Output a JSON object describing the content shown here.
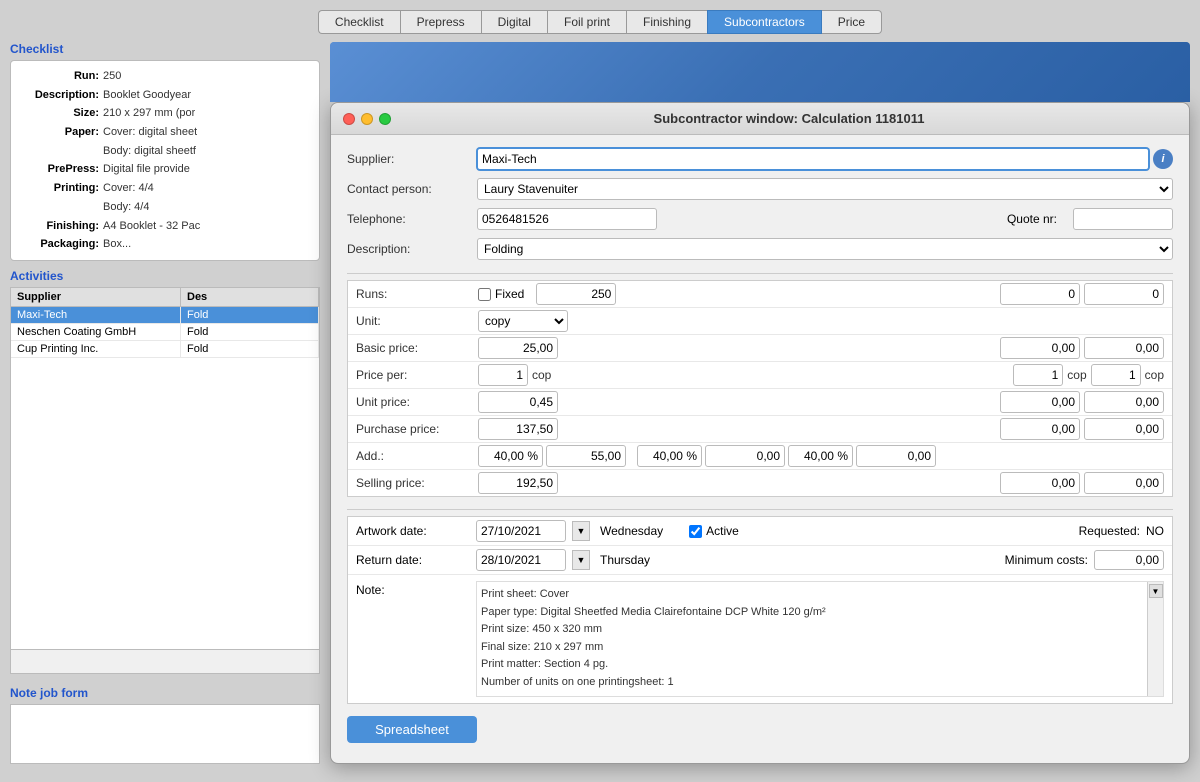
{
  "tabs": [
    {
      "id": "checklist",
      "label": "Checklist",
      "active": false
    },
    {
      "id": "prepress",
      "label": "Prepress",
      "active": false
    },
    {
      "id": "digital",
      "label": "Digital",
      "active": false
    },
    {
      "id": "foil-print",
      "label": "Foil print",
      "active": false
    },
    {
      "id": "finishing",
      "label": "Finishing",
      "active": false
    },
    {
      "id": "subcontractors",
      "label": "Subcontractors",
      "active": true
    },
    {
      "id": "price",
      "label": "Price",
      "active": false
    }
  ],
  "left_panel": {
    "checklist_title": "Checklist",
    "checklist_fields": [
      {
        "label": "Run:",
        "value": "250"
      },
      {
        "label": "Description:",
        "value": "Booklet Goodyear"
      },
      {
        "label": "Size:",
        "value": "210 x 297 mm (por"
      },
      {
        "label": "Paper:",
        "value": "Cover: digital sheet"
      },
      {
        "label": "",
        "value": "Body: digital sheetf"
      },
      {
        "label": "PrePress:",
        "value": "Digital file provide"
      },
      {
        "label": "Printing:",
        "value": "Cover: 4/4"
      },
      {
        "label": "",
        "value": "Body: 4/4"
      },
      {
        "label": "Finishing:",
        "value": "A4 Booklet - 32 Pac"
      },
      {
        "label": "Packaging:",
        "value": "Box..."
      }
    ],
    "activities_title": "Activities",
    "activities_columns": [
      "Supplier",
      "Des"
    ],
    "activities_rows": [
      {
        "supplier": "Maxi-Tech",
        "desc": "Fold",
        "selected": true
      },
      {
        "supplier": "Neschen Coating GmbH",
        "desc": "Fold",
        "selected": false
      },
      {
        "supplier": "Cup Printing Inc.",
        "desc": "Fold",
        "selected": false
      }
    ],
    "note_title": "Note job form"
  },
  "dialog": {
    "title": "Subcontractor window: Calculation 1181011",
    "supplier_label": "Supplier:",
    "supplier_value": "Maxi-Tech",
    "contact_label": "Contact person:",
    "contact_value": "Laury Stavenuiter",
    "telephone_label": "Telephone:",
    "telephone_value": "0526481526",
    "quote_label": "Quote nr:",
    "quote_value": "",
    "description_label": "Description:",
    "description_value": "Folding",
    "runs_label": "Runs:",
    "fixed_label": "Fixed",
    "runs_col1": "250",
    "runs_col2": "0",
    "runs_col3": "0",
    "unit_label": "Unit:",
    "unit_value": "copy",
    "basic_price_label": "Basic price:",
    "basic_col1": "25,00",
    "basic_col2": "0,00",
    "basic_col3": "0,00",
    "price_per_label": "Price per:",
    "price_per_col1_num": "1",
    "price_per_col1_unit": "cop",
    "price_per_col2_num": "1",
    "price_per_col2_unit": "cop",
    "price_per_col3_num": "1",
    "price_per_col3_unit": "cop",
    "unit_price_label": "Unit price:",
    "unit_price_col1": "0,45",
    "unit_price_col2": "0,00",
    "unit_price_col3": "0,00",
    "purchase_price_label": "Purchase price:",
    "purchase_col1": "137,50",
    "purchase_col2": "0,00",
    "purchase_col3": "0,00",
    "add_label": "Add.:",
    "add_pct1": "40,00 %",
    "add_col1": "55,00",
    "add_pct2": "40,00 %",
    "add_col2": "0,00",
    "add_pct3": "40,00 %",
    "add_col3": "0,00",
    "selling_label": "Selling price:",
    "sell_col1": "192,50",
    "sell_col2": "0,00",
    "sell_col3": "0,00",
    "artwork_label": "Artwork date:",
    "artwork_date": "27/10/2021",
    "artwork_day": "Wednesday",
    "active_label": "Active",
    "requested_label": "Requested:",
    "requested_value": "NO",
    "return_label": "Return date:",
    "return_date": "28/10/2021",
    "return_day": "Thursday",
    "min_costs_label": "Minimum costs:",
    "min_costs_value": "0,00",
    "note_label": "Note:",
    "note_text": "Print sheet: Cover\nPaper type: Digital Sheetfed Media Clairefontaine DCP White 120 g/m²\nPrint size: 450 x 320 mm\nFinal size: 210 x 297 mm\nPrint matter: Section 4 pg.\nNumber of units on one printingsheet: 1",
    "spreadsheet_label": "Spreadsheet"
  },
  "icons": {
    "close": "●",
    "minimize": "●",
    "maximize": "●",
    "dropdown": "▼",
    "info": "i"
  }
}
